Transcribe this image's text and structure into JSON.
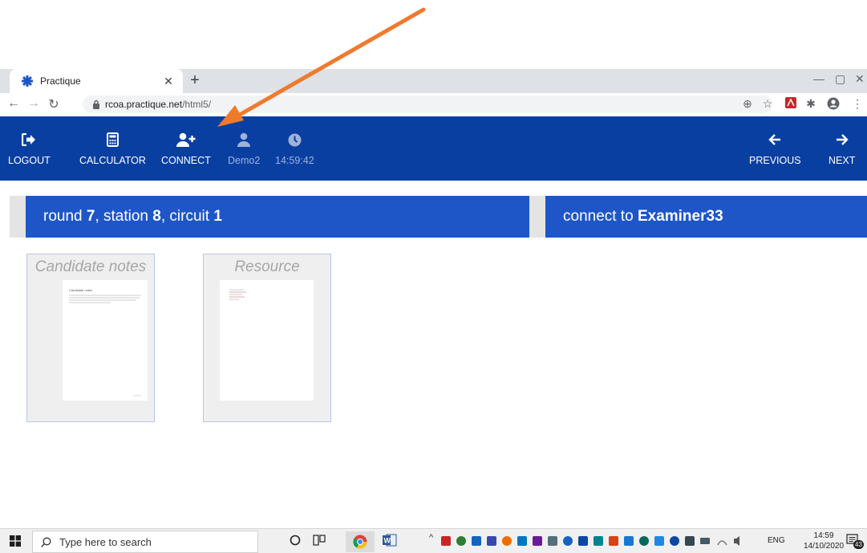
{
  "browser": {
    "tab_title": "Practique",
    "url_domain": "rcoa.practique.net",
    "url_path": "/html5/"
  },
  "appnav": {
    "logout": "LOGOUT",
    "calculator": "CALCULATOR",
    "connect": "CONNECT",
    "user": "Demo2",
    "time": "14:59:42",
    "previous": "PREVIOUS",
    "next": "NEXT"
  },
  "header_left": {
    "round_label": "round ",
    "round_value": "7",
    "station_label": ", station ",
    "station_value": "8",
    "circuit_label": ", circuit ",
    "circuit_value": "1"
  },
  "header_right": {
    "prefix": "connect to ",
    "examiner": "Examiner33"
  },
  "cards": [
    {
      "title": "Candidate notes",
      "page_heading": "Candidate notes"
    },
    {
      "title": "Resource"
    }
  ],
  "taskbar": {
    "search_placeholder": "Type here to search",
    "language": "ENG",
    "clock_time": "14:59",
    "clock_date": "14/10/2020",
    "notifications": "43"
  },
  "colors": {
    "nav_bg": "#0a3fa2",
    "header_bg": "#1e56c8",
    "annotation_arrow": "#ef7a2e"
  },
  "icons": [
    "tab-favicon-icon",
    "close-tab-icon",
    "new-tab-icon",
    "back-icon",
    "forward-icon",
    "reload-icon",
    "lock-icon",
    "zoom-icon",
    "bookmark-star-icon",
    "pdf-extension-icon",
    "extensions-icon",
    "profile-icon",
    "menu-icon",
    "logout-icon",
    "calculator-icon",
    "add-user-icon",
    "user-icon",
    "clock-icon",
    "arrow-left-icon",
    "arrow-right-icon",
    "windows-start-icon",
    "search-icon",
    "cortana-icon",
    "task-view-icon",
    "chrome-icon",
    "word-icon"
  ]
}
